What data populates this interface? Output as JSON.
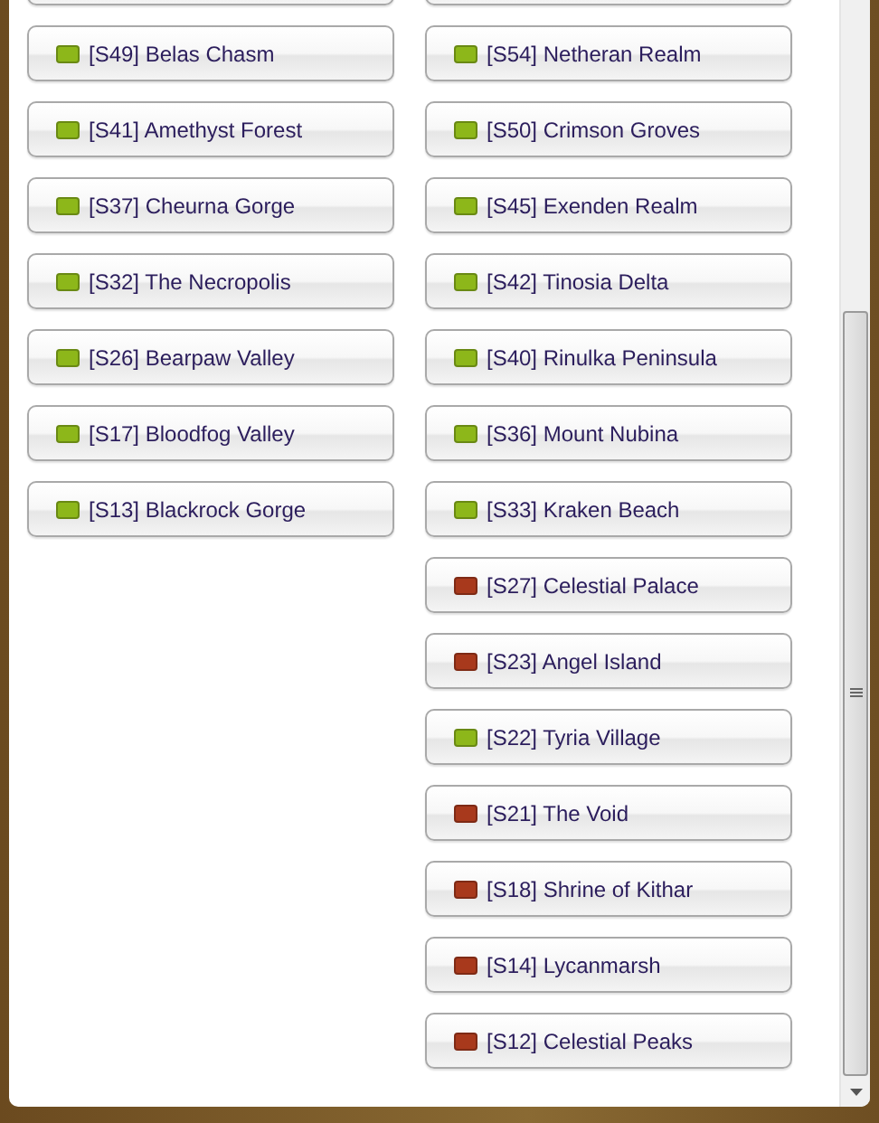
{
  "columns": [
    {
      "servers": [
        {
          "label": "[S49] Belas Chasm",
          "color": "#8db71a"
        },
        {
          "label": "[S41] Amethyst Forest",
          "color": "#8db71a"
        },
        {
          "label": "[S37] Cheurna Gorge",
          "color": "#8db71a"
        },
        {
          "label": "[S32] The Necropolis",
          "color": "#8db71a"
        },
        {
          "label": "[S26] Bearpaw Valley",
          "color": "#8db71a"
        },
        {
          "label": "[S17] Bloodfog Valley",
          "color": "#8db71a"
        },
        {
          "label": "[S13] Blackrock Gorge",
          "color": "#8db71a"
        }
      ]
    },
    {
      "servers": [
        {
          "label": "[S54] Netheran Realm",
          "color": "#8db71a"
        },
        {
          "label": "[S50] Crimson Groves",
          "color": "#8db71a"
        },
        {
          "label": "[S45] Exenden Realm",
          "color": "#8db71a"
        },
        {
          "label": "[S42] Tinosia Delta",
          "color": "#8db71a"
        },
        {
          "label": "[S40] Rinulka Peninsula",
          "color": "#8db71a"
        },
        {
          "label": "[S36] Mount Nubina",
          "color": "#8db71a"
        },
        {
          "label": "[S33] Kraken Beach",
          "color": "#8db71a"
        },
        {
          "label": "[S27] Celestial Palace",
          "color": "#a8391c"
        },
        {
          "label": "[S23] Angel Island",
          "color": "#a8391c"
        },
        {
          "label": "[S22] Tyria Village",
          "color": "#8db71a"
        },
        {
          "label": "[S21] The Void",
          "color": "#a8391c"
        },
        {
          "label": "[S18] Shrine of Kithar",
          "color": "#a8391c"
        },
        {
          "label": "[S14] Lycanmarsh",
          "color": "#a8391c"
        },
        {
          "label": "[S12] Celestial Peaks",
          "color": "#a8391c"
        }
      ]
    }
  ]
}
